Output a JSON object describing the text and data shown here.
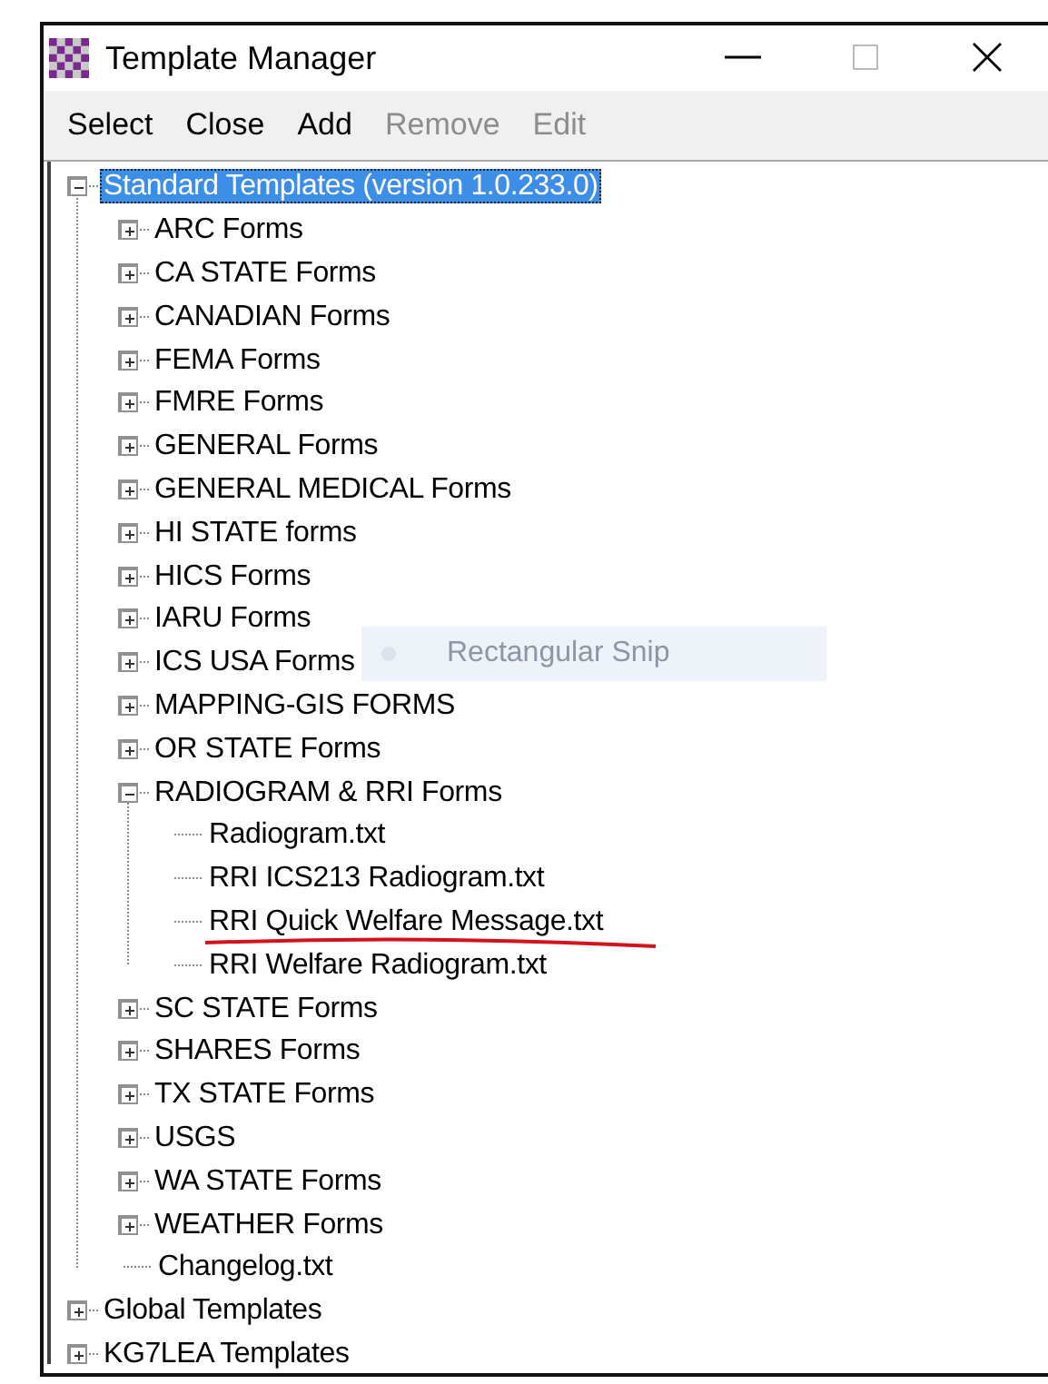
{
  "window": {
    "title": "Template Manager"
  },
  "menu": [
    {
      "label": "Select",
      "disabled": false
    },
    {
      "label": "Close",
      "disabled": false
    },
    {
      "label": "Add",
      "disabled": false
    },
    {
      "label": "Remove",
      "disabled": true
    },
    {
      "label": "Edit",
      "disabled": true
    }
  ],
  "tree": [
    {
      "label": "Standard Templates (version 1.0.233.0)",
      "selected": true,
      "expanded": true,
      "children": [
        {
          "label": "ARC Forms",
          "selected": false,
          "expanded": false
        },
        {
          "label": "CA STATE Forms",
          "selected": false,
          "expanded": false
        },
        {
          "label": "CANADIAN Forms",
          "selected": false,
          "expanded": false
        },
        {
          "label": "FEMA Forms",
          "selected": false,
          "expanded": false
        },
        {
          "label": "FMRE Forms",
          "selected": false,
          "expanded": false
        },
        {
          "label": "GENERAL Forms",
          "selected": false,
          "expanded": false
        },
        {
          "label": "GENERAL MEDICAL Forms",
          "selected": false,
          "expanded": false
        },
        {
          "label": "HI STATE forms",
          "selected": false,
          "expanded": false
        },
        {
          "label": "HICS Forms",
          "selected": false,
          "expanded": false
        },
        {
          "label": "IARU Forms",
          "selected": false,
          "expanded": false
        },
        {
          "label": "ICS USA Forms",
          "selected": false,
          "expanded": false
        },
        {
          "label": "MAPPING-GIS FORMS",
          "selected": false,
          "expanded": false
        },
        {
          "label": "OR STATE Forms",
          "selected": false,
          "expanded": false
        },
        {
          "label": "RADIOGRAM & RRI Forms",
          "selected": false,
          "expanded": true,
          "children": [
            {
              "label": "Radiogram.txt",
              "selected": false,
              "underlined": false
            },
            {
              "label": "RRI ICS213 Radiogram.txt",
              "selected": false,
              "underlined": false
            },
            {
              "label": "RRI Quick Welfare Message.txt",
              "selected": false,
              "underlined": true
            },
            {
              "label": "RRI Welfare Radiogram.txt",
              "selected": false,
              "underlined": false
            }
          ]
        },
        {
          "label": "SC STATE Forms",
          "selected": false,
          "expanded": false
        },
        {
          "label": "SHARES Forms",
          "selected": false,
          "expanded": false
        },
        {
          "label": "TX STATE Forms",
          "selected": false,
          "expanded": false
        },
        {
          "label": "USGS",
          "selected": false,
          "expanded": false
        },
        {
          "label": "WA STATE Forms",
          "selected": false,
          "expanded": false
        },
        {
          "label": "WEATHER Forms",
          "selected": false,
          "expanded": false
        },
        {
          "label": "Changelog.txt",
          "selected": false,
          "underlined": false
        }
      ]
    },
    {
      "label": "Global Templates",
      "selected": false,
      "expanded": false
    },
    {
      "label": "KG7LEA Templates",
      "selected": false,
      "expanded": false
    }
  ],
  "overlay": {
    "label": "Rectangular Snip"
  }
}
